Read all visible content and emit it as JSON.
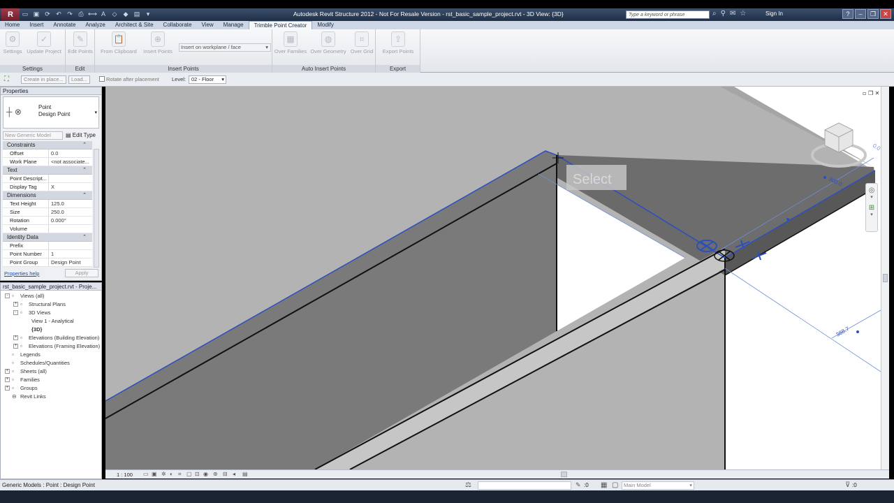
{
  "titlebar": {
    "app_logo": "R",
    "title": "Autodesk Revit Structure 2012 - Not For Resale Version -    rst_basic_sample_project.rvt - 3D View: {3D}",
    "search_placeholder": "Type a keyword or phrase",
    "signin": "Sign In"
  },
  "ribbon_tabs": [
    "Home",
    "Insert",
    "Annotate",
    "Analyze",
    "Architect & Site",
    "Collaborate",
    "View",
    "Manage",
    "Trimble Point Creator",
    "Modify"
  ],
  "active_tab": "Trimble Point Creator",
  "ribbon": {
    "settings": "Settings",
    "update_project": "Update Project",
    "edit_points": "Edit Points",
    "from_clipboard": "From Clipboard",
    "insert_points": "Insert Points",
    "insert_mode": "Insert on workplane / face",
    "over_families": "Over Families",
    "over_geometry": "Over Geometry",
    "over_grid": "Over Grid",
    "export_points": "Export Points",
    "panels": {
      "settings": "Settings",
      "edit": "Edit",
      "insert_points": "Insert Points",
      "auto_insert": "Auto Insert Points",
      "export": "Export"
    }
  },
  "optbar": {
    "create_in_place": "Create in place...",
    "load": "Load...",
    "rotate_after": "Rotate after placement",
    "level_label": "Level:",
    "level_value": "02 - Floor"
  },
  "properties": {
    "title": "Properties",
    "type_name_1": "Point",
    "type_name_2": "Design Point",
    "instance_filter": "New Generic Model",
    "edit_type": "Edit Type",
    "groups": [
      {
        "name": "Constraints",
        "rows": [
          {
            "k": "Offset",
            "v": "0.0"
          },
          {
            "k": "Work Plane",
            "v": "<not associate..."
          }
        ]
      },
      {
        "name": "Text",
        "rows": [
          {
            "k": "Point Descript...",
            "v": ""
          },
          {
            "k": "Display Tag",
            "v": "X"
          }
        ]
      },
      {
        "name": "Dimensions",
        "rows": [
          {
            "k": "Text Height",
            "v": "125.0"
          },
          {
            "k": "Size",
            "v": "250.0"
          },
          {
            "k": "Rotation",
            "v": "0.000°"
          },
          {
            "k": "Volume",
            "v": ""
          }
        ]
      },
      {
        "name": "Identity Data",
        "rows": [
          {
            "k": "Prefix",
            "v": ""
          },
          {
            "k": "Point Number",
            "v": "1"
          },
          {
            "k": "Point Group",
            "v": "Design Point"
          }
        ]
      }
    ],
    "help": "Properties help",
    "apply": "Apply"
  },
  "browser": {
    "title": "rst_basic_sample_project.rvt - Proje...",
    "nodes": [
      {
        "label": "Views (all)",
        "depth": 0,
        "exp": "-"
      },
      {
        "label": "Structural Plans",
        "depth": 1,
        "exp": "+"
      },
      {
        "label": "3D Views",
        "depth": 1,
        "exp": "-"
      },
      {
        "label": "View 1 - Analytical",
        "depth": 2,
        "exp": ""
      },
      {
        "label": "{3D}",
        "depth": 2,
        "exp": ""
      },
      {
        "label": "Elevations (Building Elevation)",
        "depth": 1,
        "exp": "+"
      },
      {
        "label": "Elevations (Framing Elevation)",
        "depth": 1,
        "exp": "+"
      },
      {
        "label": "Legends",
        "depth": 0,
        "exp": ""
      },
      {
        "label": "Schedules/Quantities",
        "depth": 0,
        "exp": ""
      },
      {
        "label": "Sheets (all)",
        "depth": 0,
        "exp": "+"
      },
      {
        "label": "Families",
        "depth": 0,
        "exp": "+"
      },
      {
        "label": "Groups",
        "depth": 0,
        "exp": "+"
      },
      {
        "label": "Revit Links",
        "depth": 0,
        "exp": ""
      }
    ]
  },
  "canvas": {
    "select_tooltip": "Select",
    "dim_1": "300.0",
    "dim_2": "388.7",
    "dim_3": "0.0"
  },
  "viewbar": {
    "scale": "1 : 100"
  },
  "statusbar": {
    "status": "Generic Models : Point : Design Point",
    "filter_value": ":0",
    "model": "Main Model",
    "selection_count": ":0"
  },
  "colors": {
    "titlebar": "#2a3b55",
    "selection_blue": "#2b4fbf",
    "wall_dark": "#7d7d7d",
    "slab_light": "#b3b3b3"
  }
}
